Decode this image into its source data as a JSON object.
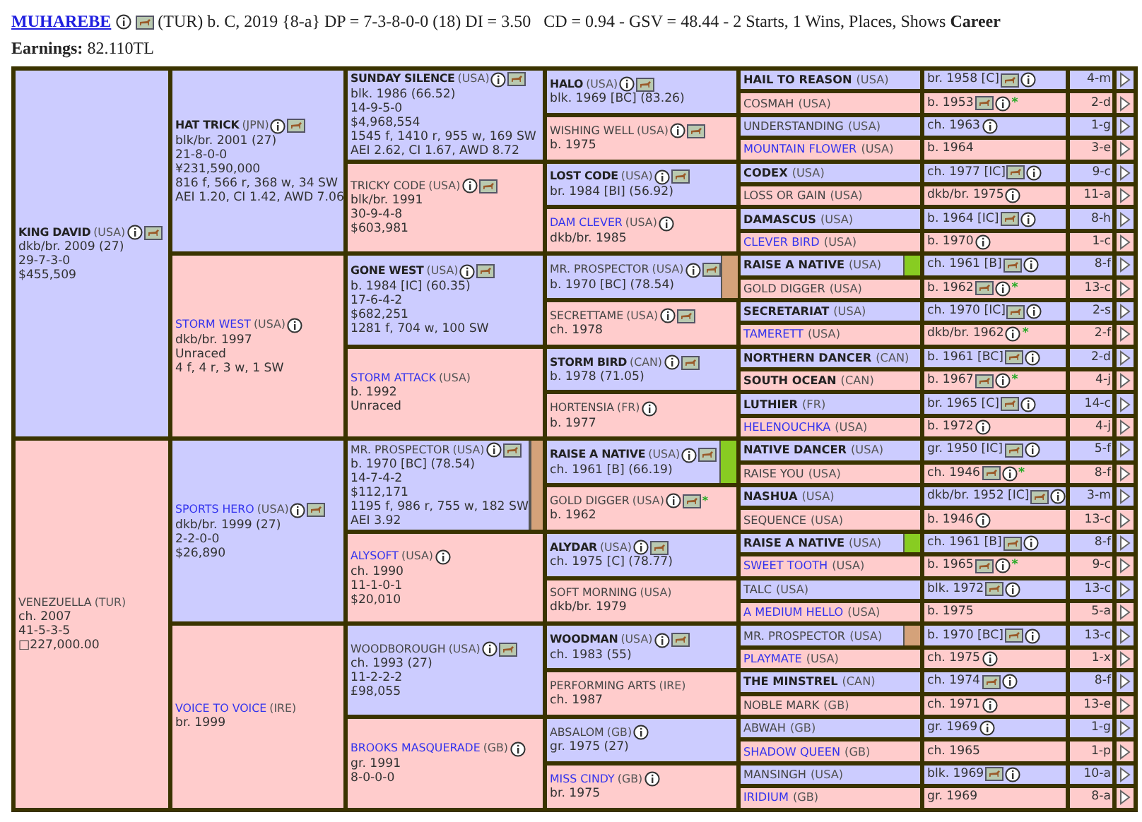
{
  "header": {
    "title": "MUHAREBE",
    "info": true,
    "photo": true,
    "summary": "(TUR) b. C, 2019 {8-a} DP = 7-3-8-0-0 (18) DI = 3.50   CD = 0.94 - GSV = 48.44 - 2 Starts, 1 Wins, Places, Shows **Career**",
    "earnings": "**Earnings:** 82.110TL"
  },
  "pedigree": {
    "parents": [
      {
        "name": "KING DAVID",
        "country": "(USA)",
        "kind": "bold",
        "info": true,
        "photo": true,
        "lines": [
          "dkb/br. 2009 (27)",
          "29-7-3-0",
          "$455,509"
        ],
        "parents": [
          {
            "name": "HAT TRICK",
            "country": "(JPN)",
            "kind": "bold",
            "info": true,
            "photo": true,
            "lines": [
              "blk/br. 2001 (27)",
              "21-8-0-0",
              "¥231,590,000",
              "816 f, 566 r, 368 w, 34 SW",
              "AEI 1.20, CI 1.42, AWD 7.06"
            ],
            "parents": [
              {
                "name": "SUNDAY SILENCE",
                "country": "(USA)",
                "kind": "bold",
                "info": true,
                "photo": true,
                "lines": [
                  "blk. 1986 (66.52)",
                  "14-9-5-0",
                  "$4,968,554",
                  "1545 f, 1410 r, 955 w, 169 SW",
                  "AEI 2.62, CI 1.67, AWD 8.72"
                ],
                "parents": [
                  {
                    "name": "HALO",
                    "country": "(USA)",
                    "kind": "bold",
                    "info": true,
                    "photo": true,
                    "lines": [
                      "blk. 1969 [BC] (83.26)"
                    ],
                    "parents": [
                      {
                        "name": "HAIL TO REASON",
                        "country": "(USA)",
                        "kind": "bold",
                        "detail": "br. 1958 [C]",
                        "photo": true,
                        "info": true,
                        "code": "4-m"
                      },
                      {
                        "name": "COSMAH",
                        "country": "(USA)",
                        "kind": "plain",
                        "detail": "b. 1953",
                        "photo": true,
                        "info": true,
                        "star": "*",
                        "code": "2-d"
                      }
                    ]
                  },
                  {
                    "name": "WISHING WELL",
                    "country": "(USA)",
                    "kind": "plain",
                    "info": true,
                    "photo": true,
                    "lines": [
                      "b. 1975"
                    ],
                    "parents": [
                      {
                        "name": "UNDERSTANDING",
                        "country": "(USA)",
                        "kind": "plain",
                        "detail": "ch. 1963",
                        "info": true,
                        "code": "1-g"
                      },
                      {
                        "name": "MOUNTAIN FLOWER",
                        "country": "(USA)",
                        "kind": "link",
                        "detail": "b. 1964",
                        "code": "3-e"
                      }
                    ]
                  }
                ]
              },
              {
                "name": "TRICKY CODE",
                "country": "(USA)",
                "kind": "plain",
                "info": true,
                "photo": true,
                "lines": [
                  "blk/br. 1991",
                  "30-9-4-8",
                  "$603,981"
                ],
                "parents": [
                  {
                    "name": "LOST CODE",
                    "country": "(USA)",
                    "kind": "bold",
                    "info": true,
                    "photo": true,
                    "lines": [
                      "br. 1984 [BI] (56.92)"
                    ],
                    "parents": [
                      {
                        "name": "CODEX",
                        "country": "(USA)",
                        "kind": "bold",
                        "detail": "ch. 1977 [IC]",
                        "photo": true,
                        "info": true,
                        "code": "9-c"
                      },
                      {
                        "name": "LOSS OR GAIN",
                        "country": "(USA)",
                        "kind": "plain",
                        "detail": "dkb/br. 1975",
                        "info": true,
                        "code": "11-a"
                      }
                    ]
                  },
                  {
                    "name": "DAM CLEVER",
                    "country": "(USA)",
                    "kind": "link",
                    "info": true,
                    "lines": [
                      "dkb/br. 1985"
                    ],
                    "parents": [
                      {
                        "name": "DAMASCUS",
                        "country": "(USA)",
                        "kind": "bold",
                        "detail": "b. 1964 [IC]",
                        "photo": true,
                        "info": true,
                        "code": "8-h"
                      },
                      {
                        "name": "CLEVER BIRD",
                        "country": "(USA)",
                        "kind": "link",
                        "detail": "b. 1970",
                        "info": true,
                        "code": "1-c"
                      }
                    ]
                  }
                ]
              }
            ]
          },
          {
            "name": "STORM WEST",
            "country": "(USA)",
            "kind": "link",
            "info": true,
            "lines": [
              "dkb/br. 1997",
              "Unraced",
              "4 f, 4 r, 3 w, 1 SW"
            ],
            "parents": [
              {
                "name": "GONE WEST",
                "country": "(USA)",
                "kind": "bold",
                "info": true,
                "photo": true,
                "lines": [
                  "b. 1984 [IC] (60.35)",
                  "17-6-4-2",
                  "$682,251",
                  "1281 f, 704 w, 100 SW"
                ],
                "parents": [
                  {
                    "name": "MR. PROSPECTOR",
                    "country": "(USA)",
                    "kind": "plain",
                    "info": true,
                    "photo": true,
                    "color": "#d4a27a",
                    "lines": [
                      "b. 1970 [BC] (78.54)"
                    ],
                    "parents": [
                      {
                        "name": "RAISE A NATIVE",
                        "country": "(USA)",
                        "kind": "bold",
                        "detail": "ch. 1961 [B]",
                        "photo": true,
                        "info": true,
                        "color": "#88cc22",
                        "code": "8-f"
                      },
                      {
                        "name": "GOLD DIGGER",
                        "country": "(USA)",
                        "kind": "plain",
                        "detail": "b. 1962",
                        "photo": true,
                        "info": true,
                        "star": "*",
                        "code": "13-c"
                      }
                    ]
                  },
                  {
                    "name": "SECRETTAME",
                    "country": "(USA)",
                    "kind": "plain",
                    "info": true,
                    "photo": true,
                    "lines": [
                      "ch. 1978"
                    ],
                    "parents": [
                      {
                        "name": "SECRETARIAT",
                        "country": "(USA)",
                        "kind": "bold",
                        "detail": "ch. 1970 [IC]",
                        "photo": true,
                        "info": true,
                        "code": "2-s"
                      },
                      {
                        "name": "TAMERETT",
                        "country": "(USA)",
                        "kind": "link",
                        "detail": "dkb/br. 1962",
                        "info": true,
                        "star": "*",
                        "code": "2-f"
                      }
                    ]
                  }
                ]
              },
              {
                "name": "STORM ATTACK",
                "country": "(USA)",
                "kind": "link",
                "lines": [
                  "b. 1992",
                  "Unraced"
                ],
                "parents": [
                  {
                    "name": "STORM BIRD",
                    "country": "(CAN)",
                    "kind": "bold",
                    "info": true,
                    "photo": true,
                    "lines": [
                      "b. 1978 (71.05)"
                    ],
                    "parents": [
                      {
                        "name": "NORTHERN DANCER",
                        "country": "(CAN)",
                        "kind": "bold",
                        "detail": "b. 1961 [BC]",
                        "photo": true,
                        "info": true,
                        "code": "2-d"
                      },
                      {
                        "name": "SOUTH OCEAN",
                        "country": "(CAN)",
                        "kind": "bold",
                        "detail": "b. 1967",
                        "photo": true,
                        "info": true,
                        "star": "*",
                        "code": "4-j"
                      }
                    ]
                  },
                  {
                    "name": "HORTENSIA",
                    "country": "(FR)",
                    "kind": "plain",
                    "info": true,
                    "lines": [
                      "b. 1977"
                    ],
                    "parents": [
                      {
                        "name": "LUTHIER",
                        "country": "(FR)",
                        "kind": "bold",
                        "detail": "br. 1965 [C]",
                        "photo": true,
                        "info": true,
                        "code": "14-c"
                      },
                      {
                        "name": "HELENOUCHKA",
                        "country": "(USA)",
                        "kind": "link",
                        "detail": "b. 1972",
                        "info": true,
                        "code": "4-j"
                      }
                    ]
                  }
                ]
              }
            ]
          }
        ]
      },
      {
        "name": "VENEZUELLA",
        "country": "(TUR)",
        "kind": "plain",
        "lines": [
          "ch. 2007",
          "41-5-3-5",
          "□227,000.00"
        ],
        "parents": [
          {
            "name": "SPORTS HERO",
            "country": "(USA)",
            "kind": "link",
            "info": true,
            "photo": true,
            "lines": [
              "dkb/br. 1999 (27)",
              "2-2-0-0",
              "$26,890"
            ],
            "parents": [
              {
                "name": "MR. PROSPECTOR",
                "country": "(USA)",
                "kind": "plain",
                "info": true,
                "photo": true,
                "color": "#d4a27a",
                "lines": [
                  "b. 1970 [BC] (78.54)",
                  "14-7-4-2",
                  "$112,171",
                  "1195 f, 986 r, 755 w, 182 SW",
                  "AEI 3.92"
                ],
                "parents": [
                  {
                    "name": "RAISE A NATIVE",
                    "country": "(USA)",
                    "kind": "bold",
                    "info": true,
                    "photo": true,
                    "color": "#88cc22",
                    "lines": [
                      "ch. 1961 [B] (66.19)"
                    ],
                    "parents": [
                      {
                        "name": "NATIVE DANCER",
                        "country": "(USA)",
                        "kind": "bold",
                        "detail": "gr. 1950 [IC]",
                        "photo": true,
                        "info": true,
                        "code": "5-f"
                      },
                      {
                        "name": "RAISE YOU",
                        "country": "(USA)",
                        "kind": "plain",
                        "detail": "ch. 1946",
                        "photo": true,
                        "info": true,
                        "star": "*",
                        "code": "8-f"
                      }
                    ]
                  },
                  {
                    "name": "GOLD DIGGER",
                    "country": "(USA)",
                    "kind": "plain",
                    "info": true,
                    "photo": true,
                    "star": "*",
                    "lines": [
                      "b. 1962"
                    ],
                    "parents": [
                      {
                        "name": "NASHUA",
                        "country": "(USA)",
                        "kind": "bold",
                        "detail": "dkb/br. 1952 [IC]",
                        "photo": true,
                        "info": true,
                        "code": "3-m"
                      },
                      {
                        "name": "SEQUENCE",
                        "country": "(USA)",
                        "kind": "plain",
                        "detail": "b. 1946",
                        "info": true,
                        "code": "13-c"
                      }
                    ]
                  }
                ]
              },
              {
                "name": "ALYSOFT",
                "country": "(USA)",
                "kind": "link",
                "info": true,
                "lines": [
                  "ch. 1990",
                  "11-1-0-1",
                  "$20,010"
                ],
                "parents": [
                  {
                    "name": "ALYDAR",
                    "country": "(USA)",
                    "kind": "bold",
                    "info": true,
                    "photo": true,
                    "lines": [
                      "ch. 1975 [C] (78.77)"
                    ],
                    "parents": [
                      {
                        "name": "RAISE A NATIVE",
                        "country": "(USA)",
                        "kind": "bold",
                        "detail": "ch. 1961 [B]",
                        "photo": true,
                        "info": true,
                        "color": "#88cc22",
                        "code": "8-f"
                      },
                      {
                        "name": "SWEET TOOTH",
                        "country": "(USA)",
                        "kind": "link",
                        "detail": "b. 1965",
                        "photo": true,
                        "info": true,
                        "star": "*",
                        "code": "9-c"
                      }
                    ]
                  },
                  {
                    "name": "SOFT MORNING",
                    "country": "(USA)",
                    "kind": "plain",
                    "lines": [
                      "dkb/br. 1979"
                    ],
                    "parents": [
                      {
                        "name": "TALC",
                        "country": "(USA)",
                        "kind": "plain",
                        "detail": "blk. 1972",
                        "photo": true,
                        "info": true,
                        "code": "13-c"
                      },
                      {
                        "name": "A MEDIUM HELLO",
                        "country": "(USA)",
                        "kind": "link",
                        "detail": "b. 1975",
                        "code": "5-a"
                      }
                    ]
                  }
                ]
              }
            ]
          },
          {
            "name": "VOICE TO VOICE",
            "country": "(IRE)",
            "kind": "link",
            "lines": [
              "br. 1999"
            ],
            "parents": [
              {
                "name": "WOODBOROUGH",
                "country": "(USA)",
                "kind": "plain",
                "info": true,
                "photo": true,
                "lines": [
                  "ch. 1993 (27)",
                  "11-2-2-2",
                  "£98,055"
                ],
                "parents": [
                  {
                    "name": "WOODMAN",
                    "country": "(USA)",
                    "kind": "bold",
                    "info": true,
                    "photo": true,
                    "lines": [
                      "ch. 1983 (55)"
                    ],
                    "parents": [
                      {
                        "name": "MR. PROSPECTOR",
                        "country": "(USA)",
                        "kind": "plain",
                        "detail": "b. 1970 [BC]",
                        "photo": true,
                        "info": true,
                        "color": "#d4a27a",
                        "code": "13-c"
                      },
                      {
                        "name": "PLAYMATE",
                        "country": "(USA)",
                        "kind": "link",
                        "detail": "ch. 1975",
                        "info": true,
                        "code": "1-x"
                      }
                    ]
                  },
                  {
                    "name": "PERFORMING ARTS",
                    "country": "(IRE)",
                    "kind": "plain",
                    "lines": [
                      "ch. 1987"
                    ],
                    "parents": [
                      {
                        "name": "THE MINSTREL",
                        "country": "(CAN)",
                        "kind": "bold",
                        "detail": "ch. 1974",
                        "photo": true,
                        "info": true,
                        "code": "8-f"
                      },
                      {
                        "name": "NOBLE MARK",
                        "country": "(GB)",
                        "kind": "plain",
                        "detail": "ch. 1971",
                        "info": true,
                        "code": "13-e"
                      }
                    ]
                  }
                ]
              },
              {
                "name": "BROOKS MASQUERADE",
                "country": "(GB)",
                "kind": "link",
                "info": true,
                "lines": [
                  "gr. 1991",
                  "8-0-0-0"
                ],
                "parents": [
                  {
                    "name": "ABSALOM",
                    "country": "(GB)",
                    "kind": "plain",
                    "info": true,
                    "lines": [
                      "gr. 1975 (27)"
                    ],
                    "parents": [
                      {
                        "name": "ABWAH",
                        "country": "(GB)",
                        "kind": "plain",
                        "detail": "gr. 1969",
                        "info": true,
                        "code": "1-g"
                      },
                      {
                        "name": "SHADOW QUEEN",
                        "country": "(GB)",
                        "kind": "link",
                        "detail": "ch. 1965",
                        "code": "1-p"
                      }
                    ]
                  },
                  {
                    "name": "MISS CINDY",
                    "country": "(GB)",
                    "kind": "link",
                    "info": true,
                    "lines": [
                      "br. 1975"
                    ],
                    "parents": [
                      {
                        "name": "MANSINGH",
                        "country": "(USA)",
                        "kind": "plain",
                        "detail": "blk. 1969",
                        "photo": true,
                        "info": true,
                        "code": "10-a"
                      },
                      {
                        "name": "IRIDIUM",
                        "country": "(GB)",
                        "kind": "link",
                        "detail": "gr. 1969",
                        "code": "8-a"
                      }
                    ]
                  }
                ]
              }
            ]
          }
        ]
      }
    ]
  }
}
